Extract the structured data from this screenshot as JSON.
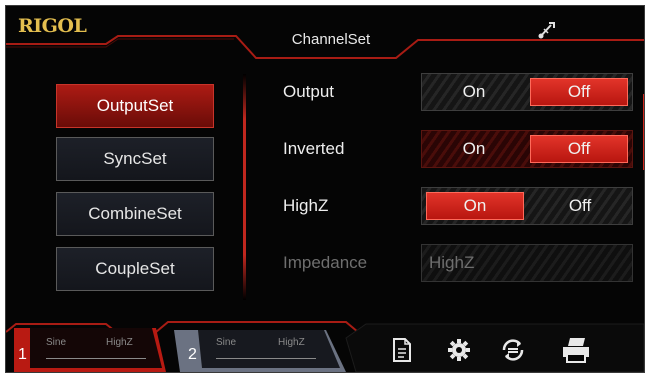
{
  "header": {
    "logo": "RIGOL",
    "title": "ChannelSet",
    "usb_icon": "usb-icon"
  },
  "menu": {
    "items": [
      {
        "label": "OutputSet",
        "active": true
      },
      {
        "label": "SyncSet",
        "active": false
      },
      {
        "label": "CombineSet",
        "active": false
      },
      {
        "label": "CoupleSet",
        "active": false
      }
    ]
  },
  "settings": {
    "output": {
      "label": "Output",
      "on": "On",
      "off": "Off",
      "selected": "Off"
    },
    "inverted": {
      "label": "Inverted",
      "on": "On",
      "off": "Off",
      "selected": "Off"
    },
    "highz": {
      "label": "HighZ",
      "on": "On",
      "off": "Off",
      "selected": "On"
    },
    "impedance": {
      "label": "Impedance",
      "value": "HighZ"
    }
  },
  "channels": [
    {
      "number": "1",
      "wave": "Sine",
      "load": "HighZ",
      "active": true
    },
    {
      "number": "2",
      "wave": "Sine",
      "load": "HighZ",
      "active": false
    }
  ],
  "toolbar_icons": [
    "document-icon",
    "gear-icon",
    "sync-icon",
    "printer-icon"
  ],
  "colors": {
    "accent": "#c8241c",
    "logo": "#e3be4f",
    "background": "#050505"
  }
}
